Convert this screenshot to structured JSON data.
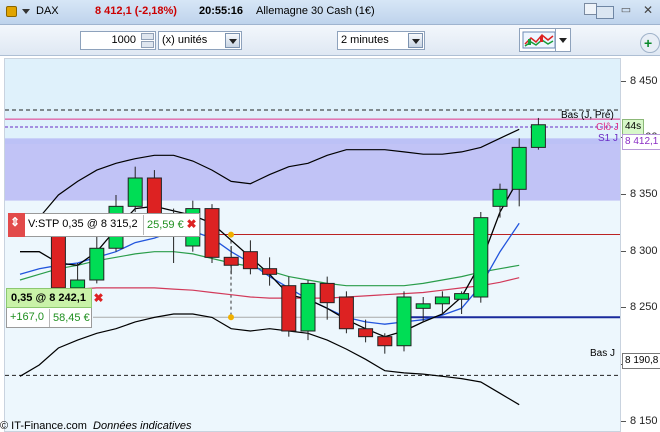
{
  "titlebar": {
    "symbol": "DAX",
    "price": "8 412,1 (-2,18%)",
    "time": "20:55:16",
    "instrument": "Allemagne 30 Cash (1€)"
  },
  "toolbar": {
    "quantity": "1000",
    "unit": "(x) unités",
    "timeframe": "2 minutes"
  },
  "axis": {
    "ticks": [
      "8 450",
      "8 400",
      "8 350",
      "8 300",
      "8 250",
      "8 200",
      "8 150"
    ],
    "price_tag": "8 412,1",
    "low_tag": "8 190,8",
    "timer_tag": "44s"
  },
  "overlay_labels": {
    "bas_top": "Bas (J, Pré)",
    "clo": "Clô J",
    "s1": "S1 J",
    "bas_j": "Bas J"
  },
  "order_stop": {
    "label": "V:STP 0,35 @ 8 315,2",
    "pnl": "25,59 €"
  },
  "position": {
    "label": "0,35 @ 8 242,1",
    "points": "+167,0",
    "value": "58,45 €"
  },
  "footer": {
    "brand": "© IT-Finance.com",
    "note": "Données indicatives"
  },
  "colors": {
    "up": "#00dd55",
    "down": "#dd2222",
    "resistance_band": "#b6b8f4",
    "support_band": "#dff1fb"
  },
  "chart_data": {
    "type": "candlestick",
    "ylim": [
      8140,
      8470
    ],
    "candles": [
      {
        "o": 8325,
        "h": 8332,
        "l": 8318,
        "c": 8322
      },
      {
        "o": 8322,
        "h": 8334,
        "l": 8316,
        "c": 8316
      },
      {
        "o": 8318,
        "h": 8320,
        "l": 8262,
        "c": 8268
      },
      {
        "o": 8268,
        "h": 8290,
        "l": 8262,
        "c": 8275
      },
      {
        "o": 8275,
        "h": 8318,
        "l": 8272,
        "c": 8303
      },
      {
        "o": 8303,
        "h": 8350,
        "l": 8300,
        "c": 8340
      },
      {
        "o": 8340,
        "h": 8375,
        "l": 8335,
        "c": 8365
      },
      {
        "o": 8365,
        "h": 8372,
        "l": 8325,
        "c": 8330
      },
      {
        "o": 8330,
        "h": 8338,
        "l": 8290,
        "c": 8315
      },
      {
        "o": 8305,
        "h": 8345,
        "l": 8300,
        "c": 8338
      },
      {
        "o": 8338,
        "h": 8342,
        "l": 8290,
        "c": 8295
      },
      {
        "o": 8295,
        "h": 8305,
        "l": 8280,
        "c": 8288
      },
      {
        "o": 8300,
        "h": 8310,
        "l": 8280,
        "c": 8285
      },
      {
        "o": 8285,
        "h": 8295,
        "l": 8270,
        "c": 8280
      },
      {
        "o": 8270,
        "h": 8278,
        "l": 8225,
        "c": 8230
      },
      {
        "o": 8230,
        "h": 8275,
        "l": 8222,
        "c": 8272
      },
      {
        "o": 8272,
        "h": 8278,
        "l": 8240,
        "c": 8255
      },
      {
        "o": 8260,
        "h": 8265,
        "l": 8228,
        "c": 8232
      },
      {
        "o": 8232,
        "h": 8240,
        "l": 8220,
        "c": 8225
      },
      {
        "o": 8225,
        "h": 8228,
        "l": 8210,
        "c": 8217
      },
      {
        "o": 8217,
        "h": 8265,
        "l": 8212,
        "c": 8260
      },
      {
        "o": 8250,
        "h": 8260,
        "l": 8238,
        "c": 8254
      },
      {
        "o": 8254,
        "h": 8265,
        "l": 8245,
        "c": 8260
      },
      {
        "o": 8258,
        "h": 8265,
        "l": 8245,
        "c": 8263
      },
      {
        "o": 8260,
        "h": 8335,
        "l": 8255,
        "c": 8330
      },
      {
        "o": 8340,
        "h": 8360,
        "l": 8330,
        "c": 8355
      },
      {
        "o": 8355,
        "h": 8400,
        "l": 8340,
        "c": 8392
      },
      {
        "o": 8392,
        "h": 8418,
        "l": 8390,
        "c": 8412
      }
    ],
    "levels": {
      "bas_veille": 8425,
      "cloture_veille": 8417,
      "s1": 8410,
      "bas_jour": 8190.8,
      "stop_order": 8315.2,
      "position_entry": 8242.1
    },
    "bollinger_upper": [
      8315,
      8330,
      8350,
      8362,
      8372,
      8378,
      8382,
      8385,
      8385,
      8380,
      8372,
      8362,
      8360,
      8368,
      8375,
      8378,
      8385,
      8390,
      8390,
      8390,
      8388,
      8386,
      8386,
      8388,
      8392,
      8400,
      8408
    ],
    "bollinger_lower": [
      8190,
      8200,
      8215,
      8222,
      8228,
      8232,
      8238,
      8242,
      8245,
      8245,
      8242,
      8232,
      8230,
      8232,
      8230,
      8228,
      8222,
      8214,
      8205,
      8195,
      8193,
      8192,
      8190,
      8188,
      8185,
      8175,
      8165
    ],
    "fast_ma": [
      8300,
      8300,
      8290,
      8288,
      8300,
      8320,
      8338,
      8340,
      8336,
      8332,
      8325,
      8310,
      8295,
      8280,
      8262,
      8258,
      8250,
      8240,
      8232,
      8225,
      8230,
      8238,
      8245,
      8260,
      8290,
      8335,
      8365
    ],
    "mid_ma": [
      8280,
      8285,
      8288,
      8290,
      8295,
      8300,
      8308,
      8312,
      8318,
      8318,
      8312,
      8300,
      8290,
      8278,
      8268,
      8258,
      8250,
      8242,
      8238,
      8236,
      8238,
      8240,
      8244,
      8250,
      8270,
      8300,
      8325
    ],
    "slow_ma": [
      8275,
      8280,
      8285,
      8288,
      8292,
      8295,
      8298,
      8300,
      8300,
      8298,
      8294,
      8290,
      8287,
      8283,
      8278,
      8275,
      8272,
      8270,
      8270,
      8270,
      8270,
      8272,
      8275,
      8278,
      8282,
      8285,
      8288
    ],
    "sma200": [
      8263,
      8264,
      8266,
      8267,
      8268,
      8268,
      8268,
      8268,
      8267,
      8266,
      8264,
      8262,
      8260,
      8259,
      8259,
      8259,
      8259,
      8260,
      8261,
      8262,
      8263,
      8264,
      8266,
      8268,
      8270,
      8273,
      8277
    ]
  }
}
